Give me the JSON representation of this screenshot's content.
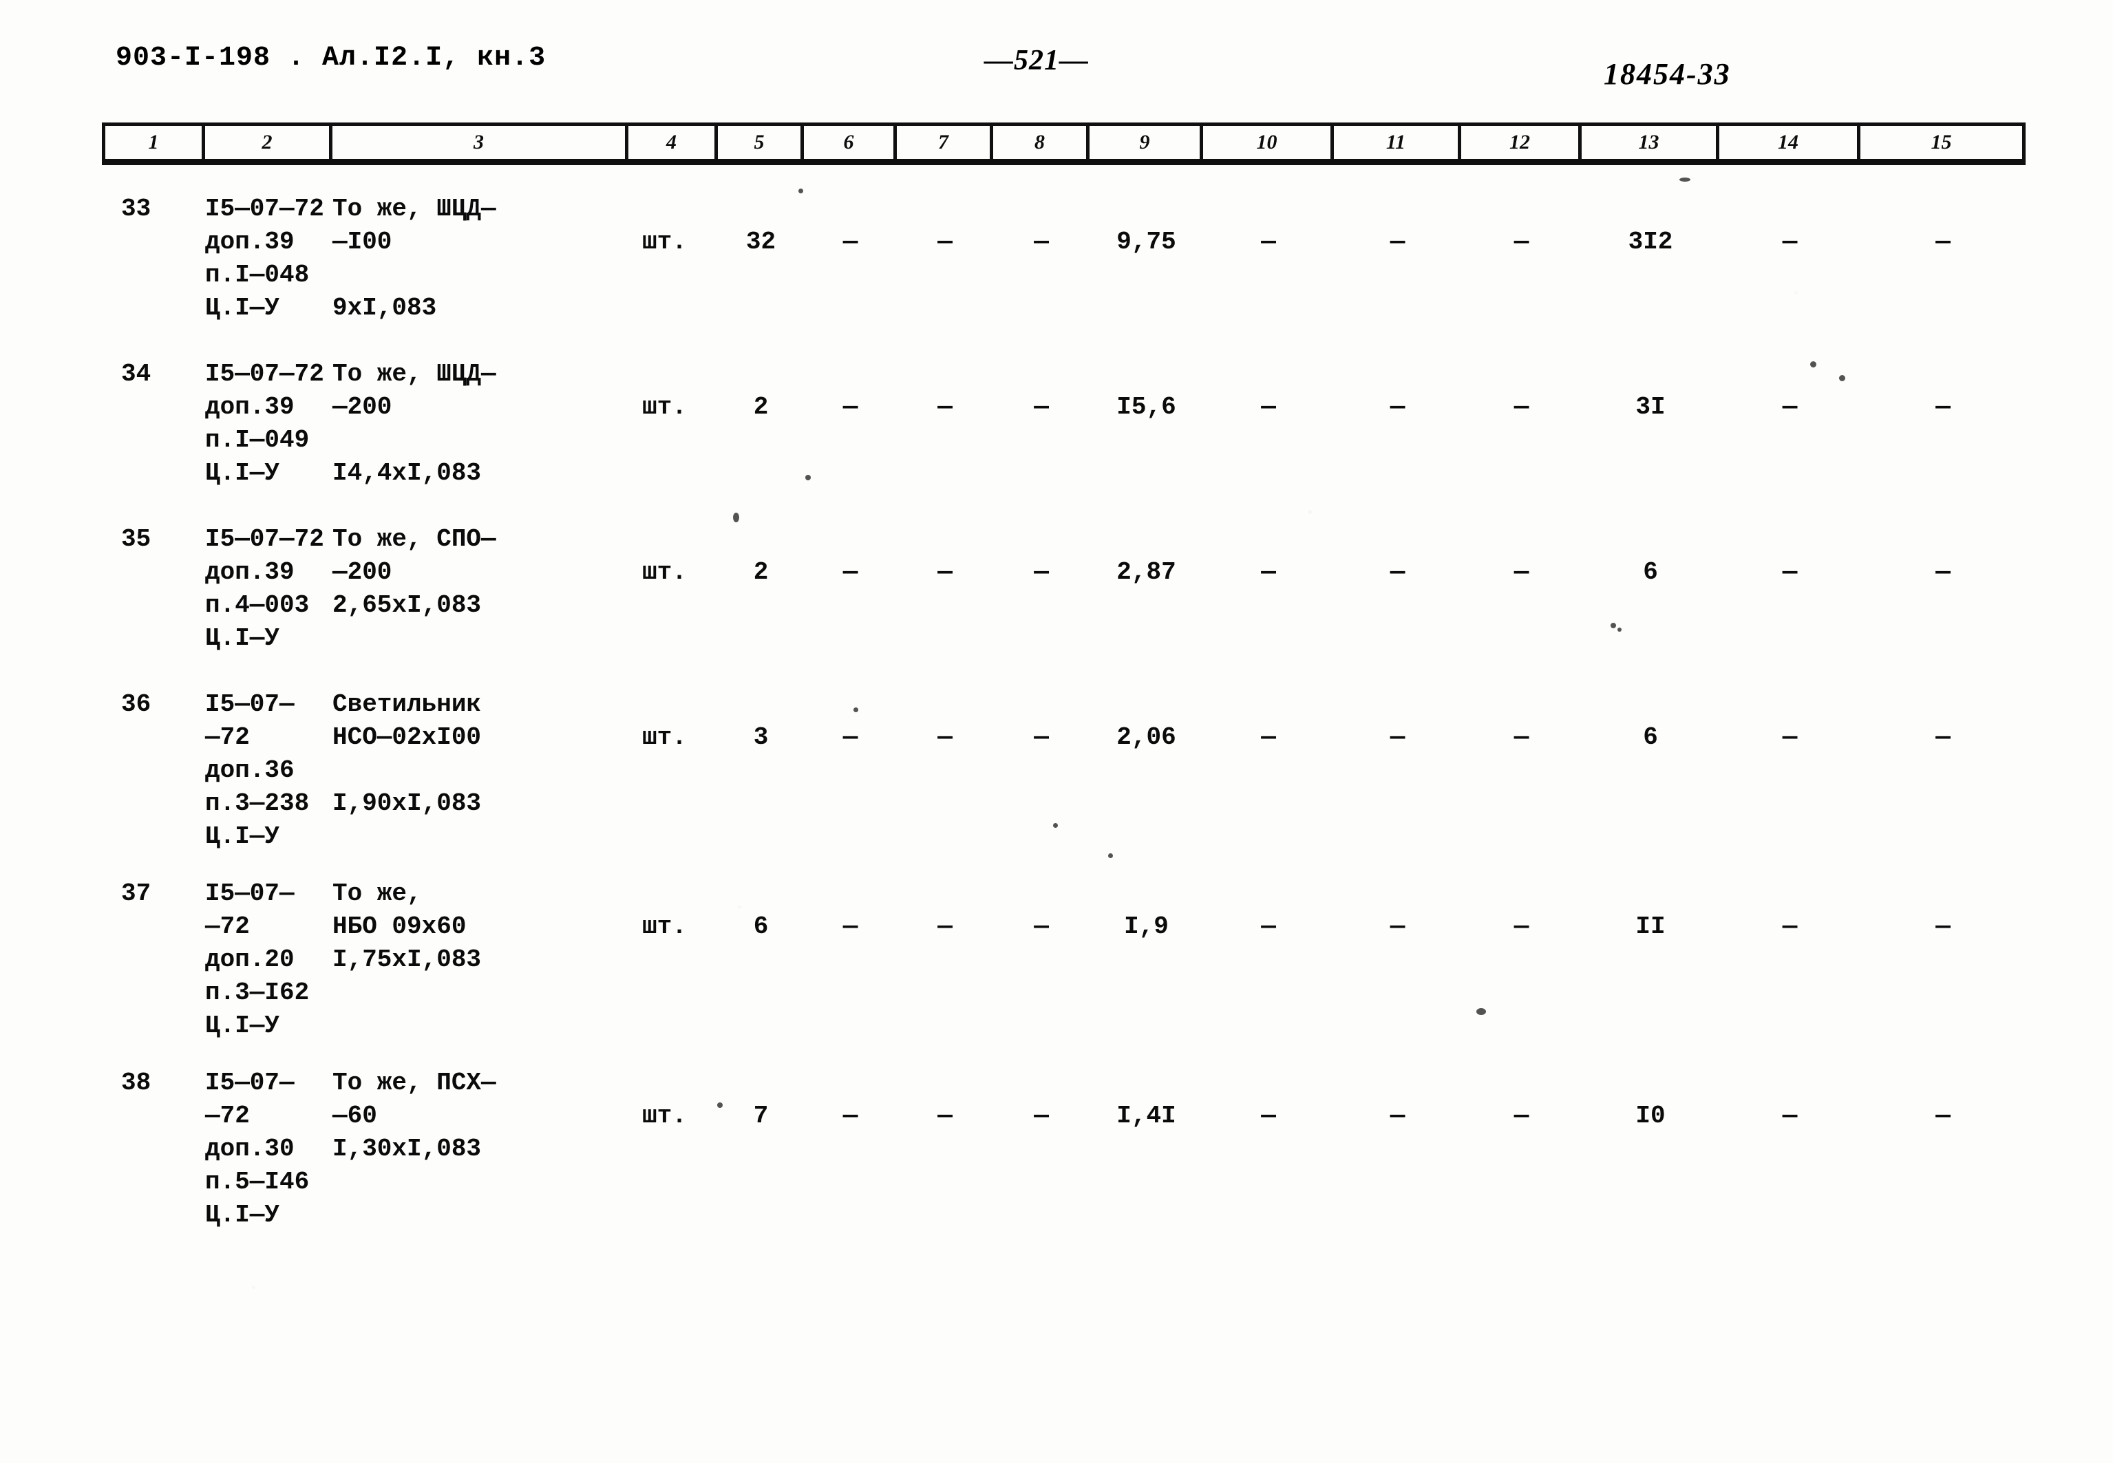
{
  "header": {
    "left_ref": "903-I-198 . Ал.I2.I, кн.3",
    "page_number": "—521—",
    "right_ref": "18454-33"
  },
  "table": {
    "column_headers": [
      "1",
      "2",
      "3",
      "4",
      "5",
      "6",
      "7",
      "8",
      "9",
      "10",
      "11",
      "12",
      "13",
      "14",
      "15"
    ],
    "rows": [
      {
        "num": "33",
        "code_lines": [
          "I5—07—72",
          "доп.39",
          "п.I—048",
          "Ц.I—У"
        ],
        "name_lines": [
          "То же, ШЦД—",
          "—I00",
          "",
          "9хI,083"
        ],
        "unit": "шт.",
        "c5": "32",
        "c6": "—",
        "c7": "—",
        "c8": "—",
        "c9": "9,75",
        "c10": "—",
        "c11": "—",
        "c12": "—",
        "c13": "3I2",
        "c14": "—",
        "c15": "—"
      },
      {
        "num": "34",
        "code_lines": [
          "I5—07—72",
          "доп.39",
          "п.I—049",
          "Ц.I—У"
        ],
        "name_lines": [
          "То же, ШЦД—",
          "—200",
          "",
          "I4,4хI,083"
        ],
        "unit": "шт.",
        "c5": "2",
        "c6": "—",
        "c7": "—",
        "c8": "—",
        "c9": "I5,6",
        "c10": "—",
        "c11": "—",
        "c12": "—",
        "c13": "3I",
        "c14": "—",
        "c15": "—"
      },
      {
        "num": "35",
        "code_lines": [
          "I5—07—72",
          "доп.39",
          "п.4—003",
          "Ц.I—У"
        ],
        "name_lines": [
          "То же, СПО—",
          "—200",
          "2,65хI,083",
          ""
        ],
        "unit": "шт.",
        "c5": "2",
        "c6": "—",
        "c7": "—",
        "c8": "—",
        "c9": "2,87",
        "c10": "—",
        "c11": "—",
        "c12": "—",
        "c13": "6",
        "c14": "—",
        "c15": "—"
      },
      {
        "num": "36",
        "code_lines": [
          "I5—07—",
          "—72",
          "доп.36",
          "п.3—238",
          "Ц.I—У"
        ],
        "name_lines": [
          "Светильник",
          "НСО—02хI00",
          "",
          "I,90хI,083",
          ""
        ],
        "unit": "шт.",
        "c5": "3",
        "c6": "—",
        "c7": "—",
        "c8": "—",
        "c9": "2,06",
        "c10": "—",
        "c11": "—",
        "c12": "—",
        "c13": "6",
        "c14": "—",
        "c15": "—"
      },
      {
        "num": "37",
        "code_lines": [
          "I5—07—",
          "—72",
          "доп.20",
          "п.3—I62",
          "Ц.I—У"
        ],
        "name_lines": [
          "То же,",
          "НБО 09х60",
          "I,75хI,083",
          "",
          ""
        ],
        "unit": "шт.",
        "c5": "6",
        "c6": "—",
        "c7": "—",
        "c8": "—",
        "c9": "I,9",
        "c10": "—",
        "c11": "—",
        "c12": "—",
        "c13": "II",
        "c14": "—",
        "c15": "—"
      },
      {
        "num": "38",
        "code_lines": [
          "I5—07—",
          "—72",
          "доп.30",
          "п.5—I46",
          "Ц.I—У"
        ],
        "name_lines": [
          "То же, ПСХ—",
          "—60",
          "I,30хI,083",
          "",
          ""
        ],
        "unit": "шт.",
        "c5": "7",
        "c6": "—",
        "c7": "—",
        "c8": "—",
        "c9": "I,4I",
        "c10": "—",
        "c11": "—",
        "c12": "—",
        "c13": "I0",
        "c14": "—",
        "c15": "—"
      }
    ]
  }
}
